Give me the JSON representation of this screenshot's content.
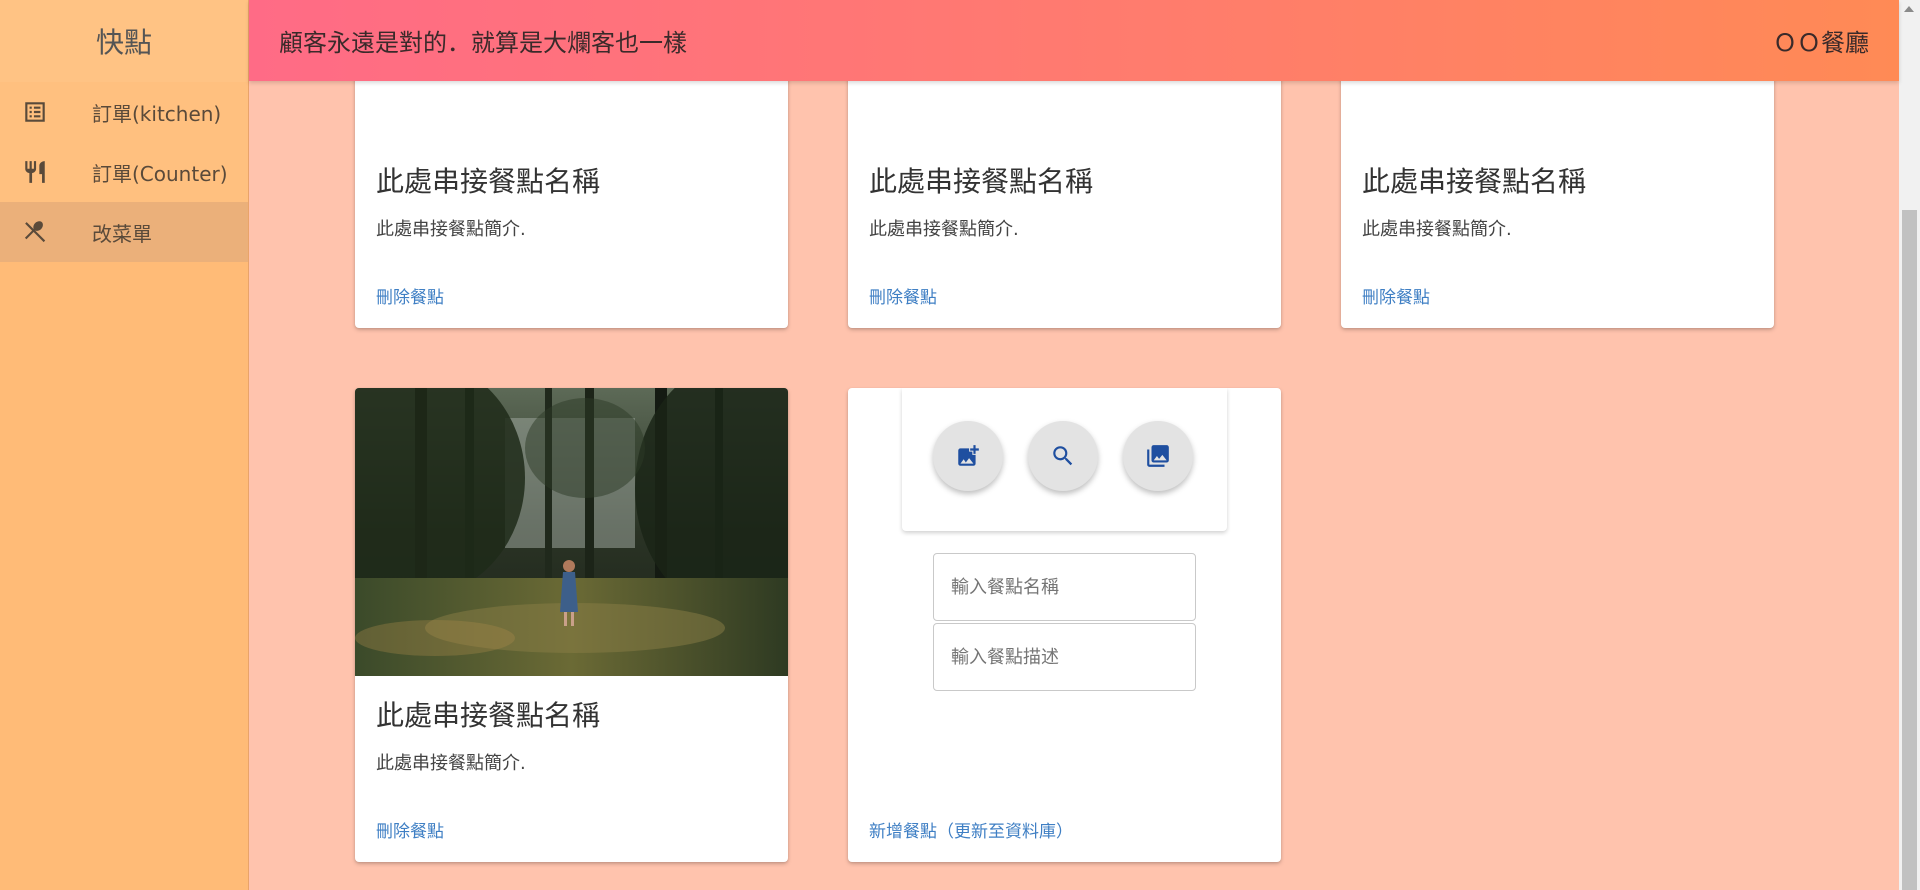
{
  "sidebar": {
    "brand": "快點",
    "items": [
      {
        "label": "訂單(kitchen)",
        "icon": "list-icon"
      },
      {
        "label": "訂單(Counter)",
        "icon": "utensils-icon"
      },
      {
        "label": "改菜單",
        "icon": "fork-spoon-icon"
      }
    ]
  },
  "topbar": {
    "slogan": "顧客永遠是對的．就算是大爛客也一樣",
    "restaurant": "ＯＯ餐廳"
  },
  "cards": [
    {
      "title": "此處串接餐點名稱",
      "desc": "此處串接餐點簡介.",
      "action": "刪除餐點"
    },
    {
      "title": "此處串接餐點名稱",
      "desc": "此處串接餐點簡介.",
      "action": "刪除餐點"
    },
    {
      "title": "此處串接餐點名稱",
      "desc": "此處串接餐點簡介.",
      "action": "刪除餐點"
    },
    {
      "title": "此處串接餐點名稱",
      "desc": "此處串接餐點簡介.",
      "action": "刪除餐點"
    }
  ],
  "add_card": {
    "name_placeholder": "輸入餐點名稱",
    "desc_placeholder": "輸入餐點描述",
    "submit": "新增餐點（更新至資料庫）",
    "icons": [
      "add-photo-icon",
      "search-icon",
      "photo-library-icon"
    ]
  },
  "colors": {
    "sidebar": "#ffbb77",
    "background": "#ffc3ad",
    "header_start": "#ff6b86",
    "header_end": "#ff8a55",
    "link": "#3f7fc4",
    "fab_icon": "#1f4fa0"
  }
}
